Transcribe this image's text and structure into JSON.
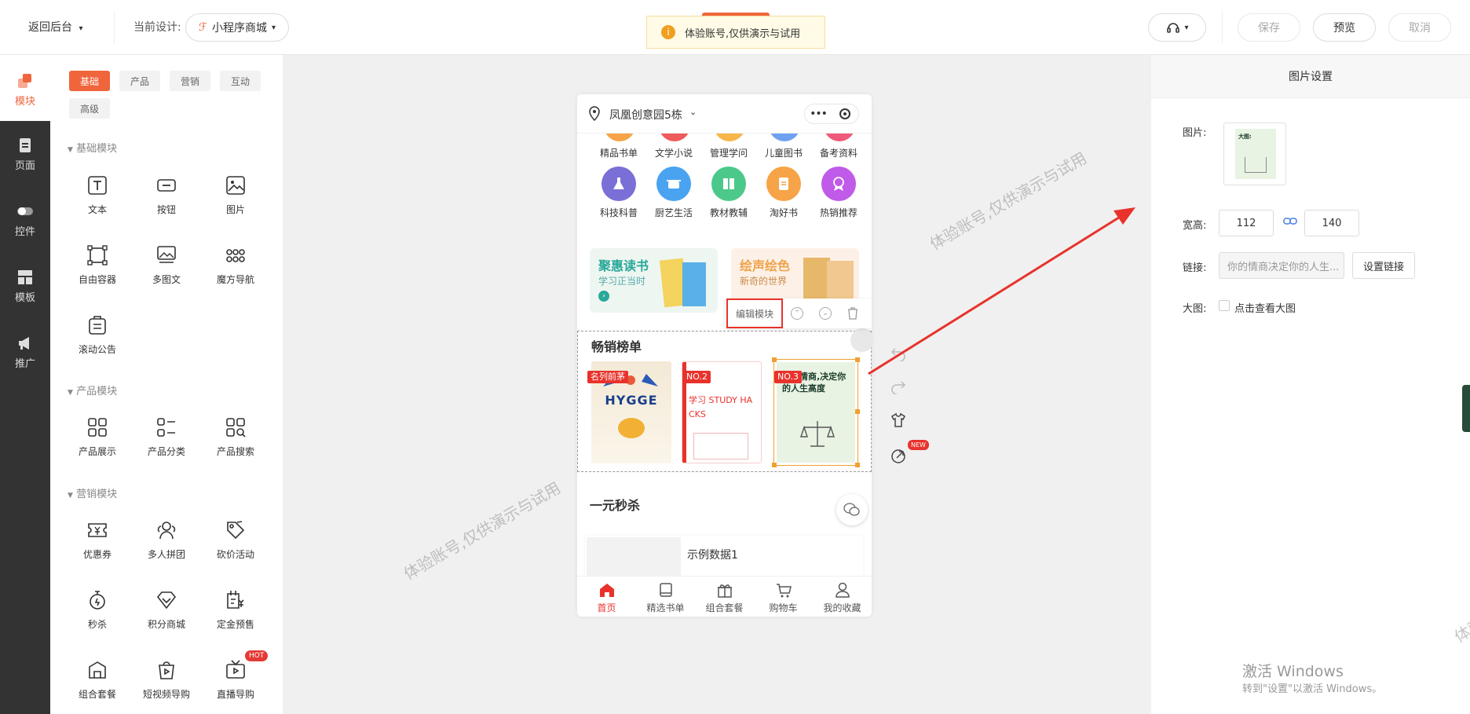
{
  "topbar": {
    "back_label": "返回后台",
    "current_design_label": "当前设计:",
    "design_name": "小程序商城",
    "notice": "体验账号,仅供演示与试用",
    "save_label": "保存",
    "preview_label": "预览",
    "cancel_label": "取消"
  },
  "rail": {
    "items": [
      {
        "label": "模块"
      },
      {
        "label": "页面"
      },
      {
        "label": "控件"
      },
      {
        "label": "模板"
      },
      {
        "label": "推广"
      }
    ]
  },
  "panel": {
    "tabs": [
      "基础",
      "产品",
      "营销",
      "互动",
      "高级"
    ],
    "sections": [
      {
        "title": "基础模块",
        "items": [
          "文本",
          "按钮",
          "图片",
          "自由容器",
          "多图文",
          "魔方导航",
          "滚动公告"
        ]
      },
      {
        "title": "产品模块",
        "items": [
          "产品展示",
          "产品分类",
          "产品搜索"
        ]
      },
      {
        "title": "营销模块",
        "items": [
          "优惠券",
          "多人拼团",
          "砍价活动",
          "秒杀",
          "积分商城",
          "定金预售",
          "组合套餐",
          "短视频导购",
          "直播导购"
        ]
      }
    ],
    "hot_badge": "HOT"
  },
  "phone": {
    "location": "凤凰创意园5栋",
    "cats_row1": [
      "精品书单",
      "文学小说",
      "管理学问",
      "儿童图书",
      "备考资料"
    ],
    "cats_row2": [
      "科技科普",
      "厨艺生活",
      "教材教辅",
      "淘好书",
      "热销推荐"
    ],
    "banner1_title": "聚惠读书",
    "banner1_sub": "学习正当时",
    "banner2_title": "绘声绘色",
    "banner2_sub": "新奇的世界",
    "edit_module": "编辑模块",
    "bestseller_title": "畅销榜单",
    "rank1": "名列前茅",
    "rank2": "NO.2",
    "rank3": "NO.3",
    "book1_title": "HYGGE",
    "book2_title": "学习 STUDY HACKS",
    "book3_title": "你的情商,决定你的人生高度",
    "seckill_title": "一元秒杀",
    "sample_item": "示例数据1",
    "tabs": [
      "首页",
      "精选书单",
      "组合套餐",
      "购物车",
      "我的收藏"
    ],
    "new_badge": "NEW"
  },
  "right": {
    "title": "图片设置",
    "image_label": "图片:",
    "size_label": "宽高:",
    "width": "112",
    "height": "140",
    "link_label": "链接:",
    "link_value": "你的情商决定你的人生...",
    "set_link": "设置链接",
    "big_label": "大图:",
    "big_check": "点击查看大图"
  },
  "watermark": "体验账号,仅供演示与试用",
  "activation": {
    "line1": "激活 Windows",
    "line2": "转到\"设置\"以激活 Windows。"
  },
  "colors": {
    "accent": "#f0653c",
    "rail_bg": "#333333",
    "arrow": "#e8322b"
  }
}
